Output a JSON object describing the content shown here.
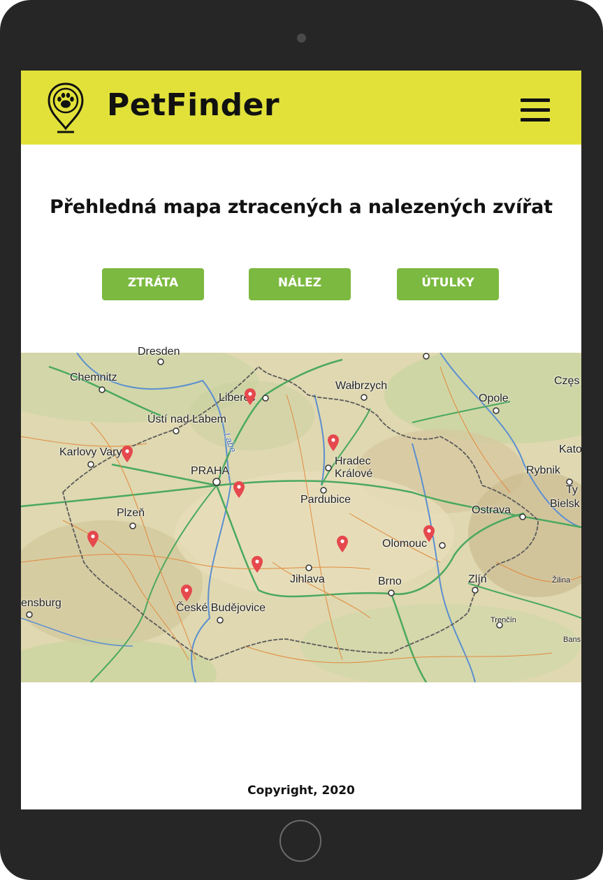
{
  "header": {
    "brand": "PetFinder",
    "logo_icon": "paw-location-pin-icon",
    "menu_icon": "hamburger-menu-icon",
    "background_color": "#e1e13a"
  },
  "main": {
    "title": "Přehledná mapa ztracených a nalezených zvířat",
    "buttons": [
      {
        "label": "ZTRÁTA"
      },
      {
        "label": "NÁLEZ"
      },
      {
        "label": "ÚTULKY"
      }
    ],
    "button_color": "#7cb940"
  },
  "map": {
    "cities": [
      {
        "name": "Dresden"
      },
      {
        "name": "Chemnitz"
      },
      {
        "name": "Liberec"
      },
      {
        "name": "Wałbrzych"
      },
      {
        "name": "Częs"
      },
      {
        "name": "Opole"
      },
      {
        "name": "Ústí nad Labem"
      },
      {
        "name": "Labe"
      },
      {
        "name": "Karlovy Vary"
      },
      {
        "name": "Hradec"
      },
      {
        "name": "Králové"
      },
      {
        "name": "Kato"
      },
      {
        "name": "Rybnik"
      },
      {
        "name": "PRAHA"
      },
      {
        "name": "Ty"
      },
      {
        "name": "Bielsk"
      },
      {
        "name": "Pardubice"
      },
      {
        "name": "Plzeň"
      },
      {
        "name": "Ostrava"
      },
      {
        "name": "Olomouc"
      },
      {
        "name": "Jihlava"
      },
      {
        "name": "Brno"
      },
      {
        "name": "Zlín"
      },
      {
        "name": "Žilina"
      },
      {
        "name": "ensburg"
      },
      {
        "name": "České Budějovice"
      },
      {
        "name": "Trenčín"
      },
      {
        "name": "Bans"
      }
    ],
    "pin_color": "#e5484d",
    "pin_icon": "map-marker-icon"
  },
  "footer": {
    "copyright": "Copyright, 2020"
  }
}
